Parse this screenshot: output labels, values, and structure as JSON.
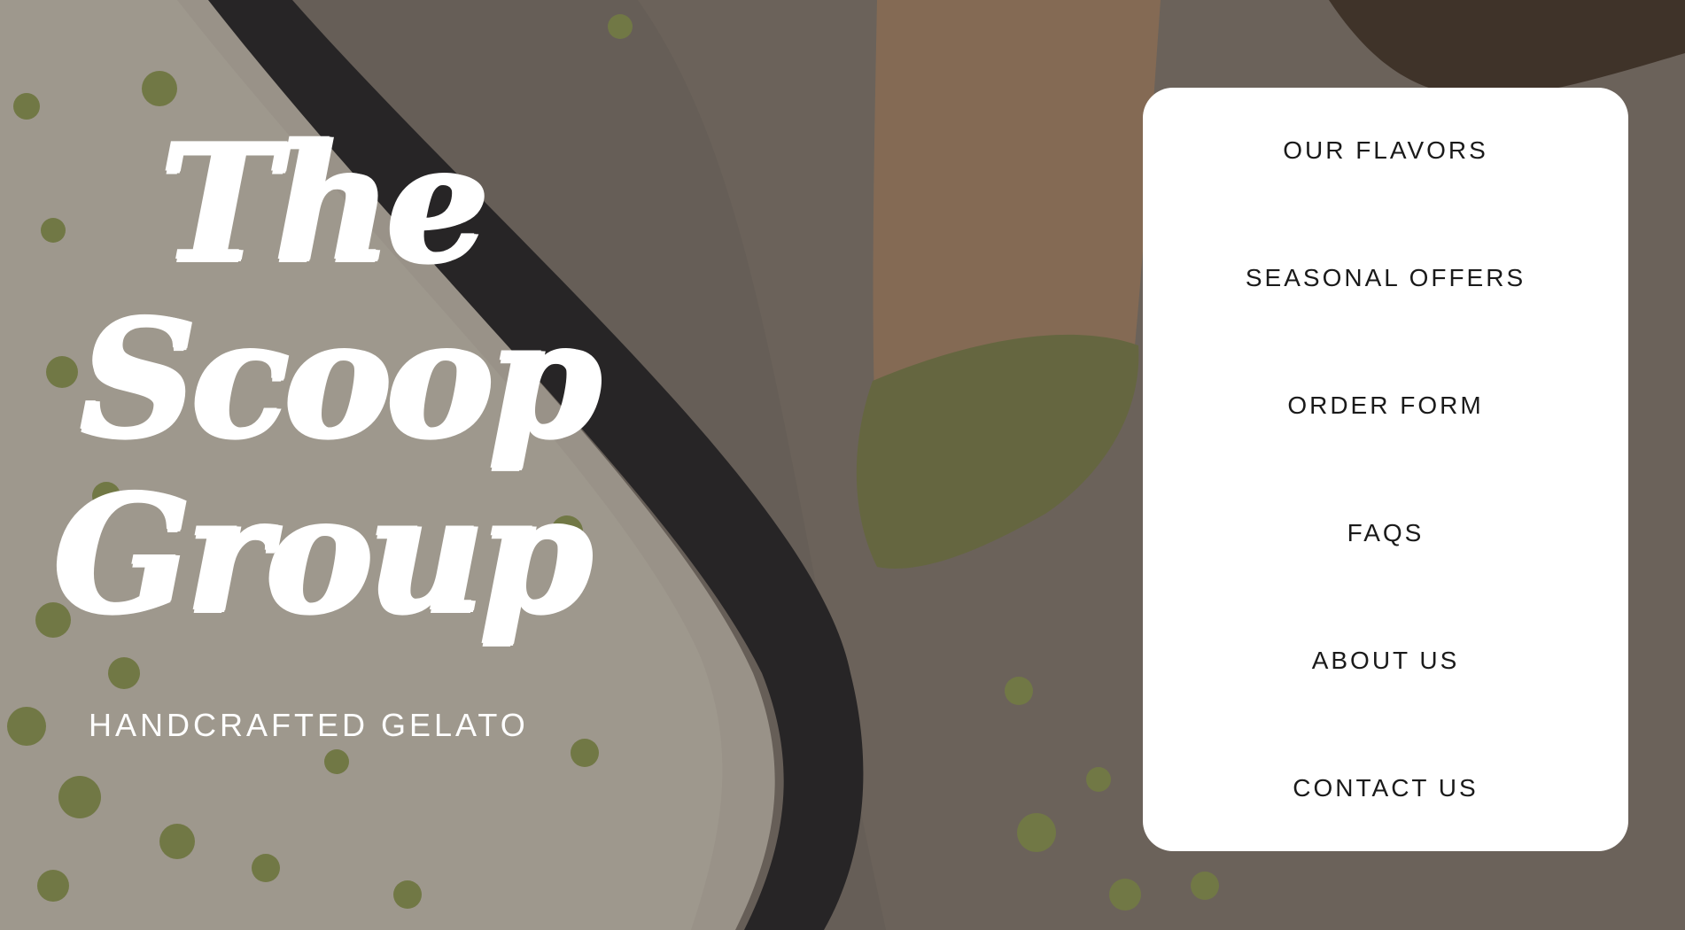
{
  "hero": {
    "title_lines": [
      "The",
      "Scoop",
      "Group"
    ],
    "tagline": "HANDCRAFTED GELATO"
  },
  "menu": {
    "items": [
      {
        "label": "OUR FLAVORS"
      },
      {
        "label": "SEASONAL OFFERS"
      },
      {
        "label": "ORDER FORM"
      },
      {
        "label": "FAQS"
      },
      {
        "label": "ABOUT US"
      },
      {
        "label": "CONTACT US"
      }
    ]
  },
  "colors": {
    "card_background": "#ffffff",
    "menu_text": "#1a1a1a",
    "title_text": "#ffffff"
  }
}
